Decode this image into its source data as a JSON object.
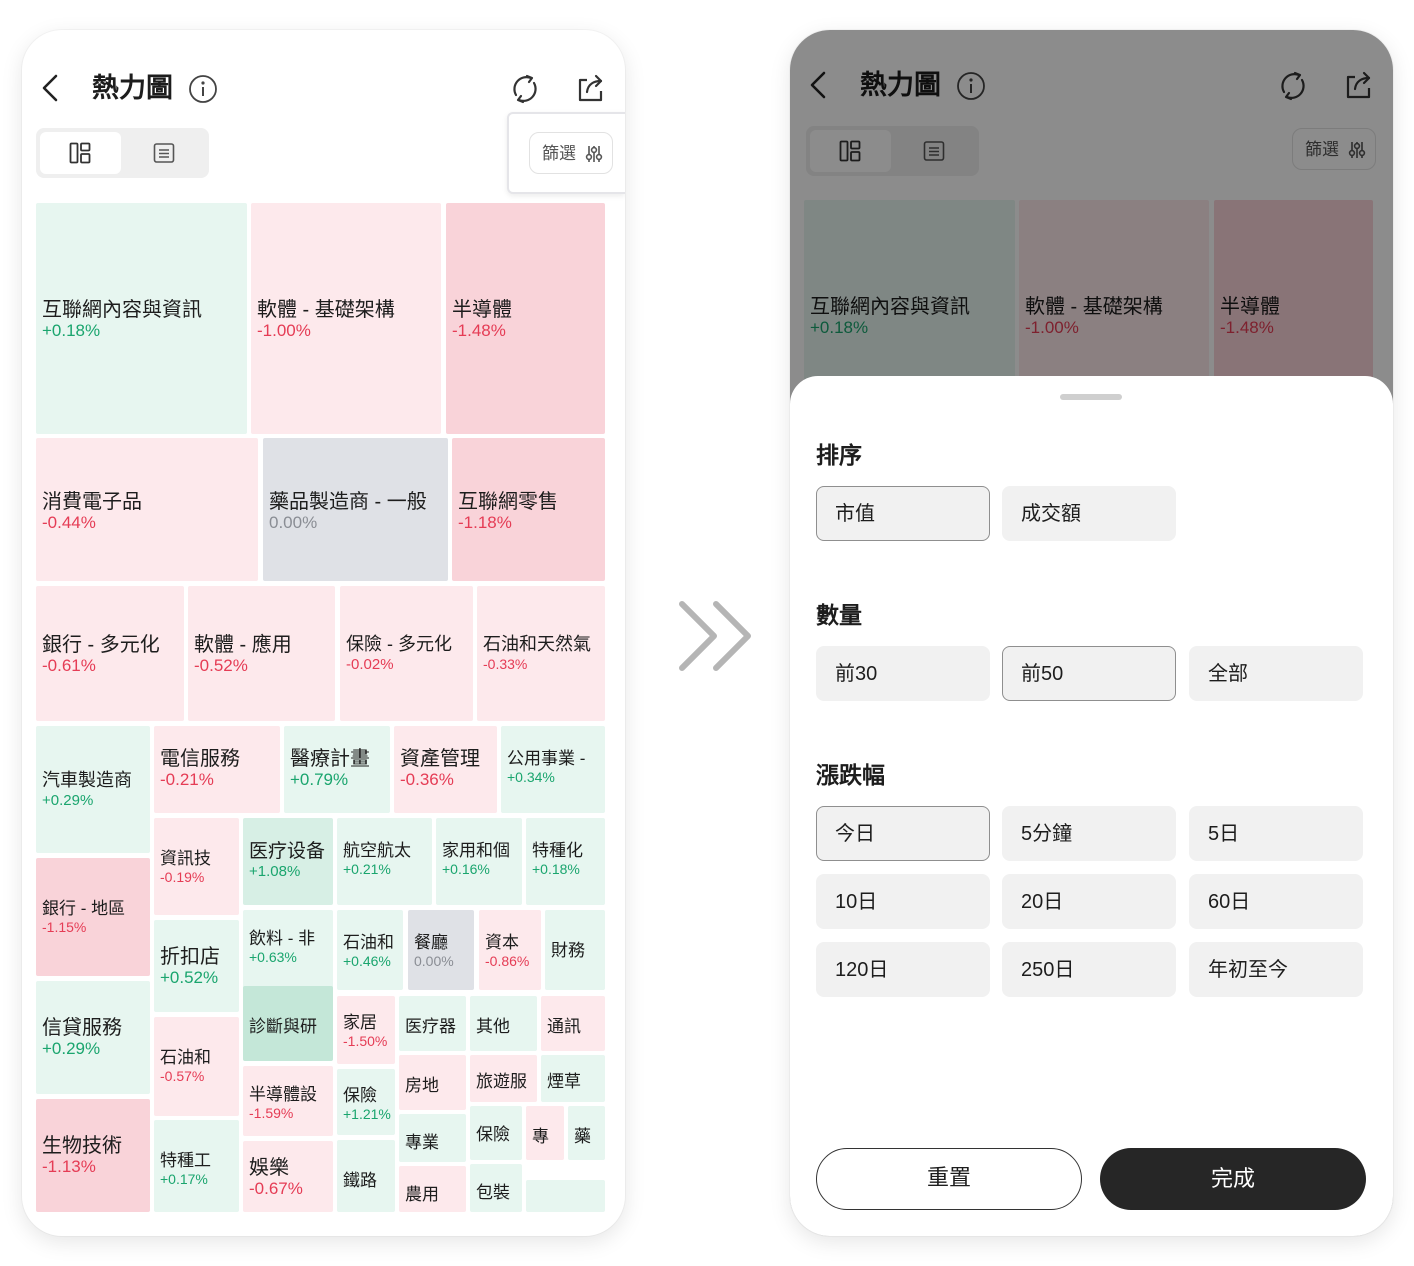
{
  "app": {
    "title": "熱力圖",
    "filter_label": "篩選"
  },
  "icons": {
    "back": "chevron-left-icon",
    "info": "info-icon",
    "refresh": "refresh-icon",
    "share": "share-icon",
    "treemap": "treemap-icon",
    "list": "list-icon",
    "filter": "sliders-icon",
    "transition": "double-chevron-right-icon"
  },
  "colors": {
    "up": "#1aa56e",
    "down": "#e53c55",
    "flat": "#8a8d94",
    "primary_button": "#262626"
  },
  "heatmap": {
    "tiles": [
      {
        "name": "互聯網內容與資訊",
        "change": "+0.18%"
      },
      {
        "name": "軟體 - 基礎架構",
        "change": "-1.00%"
      },
      {
        "name": "半導體",
        "change": "-1.48%"
      },
      {
        "name": "消費電子品",
        "change": "-0.44%"
      },
      {
        "name": "藥品製造商 - 一般",
        "change": "0.00%"
      },
      {
        "name": "互聯網零售",
        "change": "-1.18%"
      },
      {
        "name": "銀行 - 多元化",
        "change": "-0.61%"
      },
      {
        "name": "軟體 - 應用",
        "change": "-0.52%"
      },
      {
        "name": "保險 - 多元化",
        "change": "-0.02%"
      },
      {
        "name": "石油和天然氣",
        "change": "-0.33%"
      },
      {
        "name": "汽車製造商",
        "change": "+0.29%"
      },
      {
        "name": "電信服務",
        "change": "-0.21%"
      },
      {
        "name": "醫療計畫",
        "change": "+0.79%"
      },
      {
        "name": "資產管理",
        "change": "-0.36%"
      },
      {
        "name": "公用事業 -",
        "change": "+0.34%"
      },
      {
        "name": "資訊技",
        "change": "-0.19%"
      },
      {
        "name": "医疗设备",
        "change": "+1.08%"
      },
      {
        "name": "航空航太",
        "change": "+0.21%"
      },
      {
        "name": "家用和個",
        "change": "+0.16%"
      },
      {
        "name": "特種化",
        "change": "+0.18%"
      },
      {
        "name": "銀行 - 地區",
        "change": "-1.15%"
      },
      {
        "name": "折扣店",
        "change": "+0.52%"
      },
      {
        "name": "飲料 - 非",
        "change": "+0.63%"
      },
      {
        "name": "石油和",
        "change": "+0.46%"
      },
      {
        "name": "餐廳",
        "change": "0.00%"
      },
      {
        "name": "資本",
        "change": "-0.86%"
      },
      {
        "name": "財務",
        "change": ""
      },
      {
        "name": "信貸服務",
        "change": "+0.29%"
      },
      {
        "name": "診斷與研",
        "change": ""
      },
      {
        "name": "家居",
        "change": "-1.50%"
      },
      {
        "name": "医疗器",
        "change": ""
      },
      {
        "name": "其他",
        "change": ""
      },
      {
        "name": "通訊",
        "change": ""
      },
      {
        "name": "石油和",
        "change": "-0.57%"
      },
      {
        "name": "半導體設",
        "change": "-1.59%"
      },
      {
        "name": "保險",
        "change": "+1.21%"
      },
      {
        "name": "房地",
        "change": ""
      },
      {
        "name": "旅遊服",
        "change": ""
      },
      {
        "name": "煙草",
        "change": ""
      },
      {
        "name": "生物技術",
        "change": "-1.13%"
      },
      {
        "name": "特種工",
        "change": "+0.17%"
      },
      {
        "name": "娛樂",
        "change": "-0.67%"
      },
      {
        "name": "鐵路",
        "change": ""
      },
      {
        "name": "專業",
        "change": ""
      },
      {
        "name": "保險",
        "change": ""
      },
      {
        "name": "專",
        "change": ""
      },
      {
        "name": "藥",
        "change": ""
      },
      {
        "name": "農用",
        "change": ""
      },
      {
        "name": "包裝",
        "change": ""
      },
      {
        "name": "",
        "change": ""
      }
    ]
  },
  "filter_sheet": {
    "sort": {
      "title": "排序",
      "options": [
        "市值",
        "成交額"
      ],
      "selected": "市值"
    },
    "count": {
      "title": "數量",
      "options": [
        "前30",
        "前50",
        "全部"
      ],
      "selected": "前50"
    },
    "change": {
      "title": "漲跌幅",
      "options": [
        "今日",
        "5分鐘",
        "5日",
        "10日",
        "20日",
        "60日",
        "120日",
        "250日",
        "年初至今"
      ],
      "selected": "今日"
    },
    "reset_label": "重置",
    "done_label": "完成"
  }
}
